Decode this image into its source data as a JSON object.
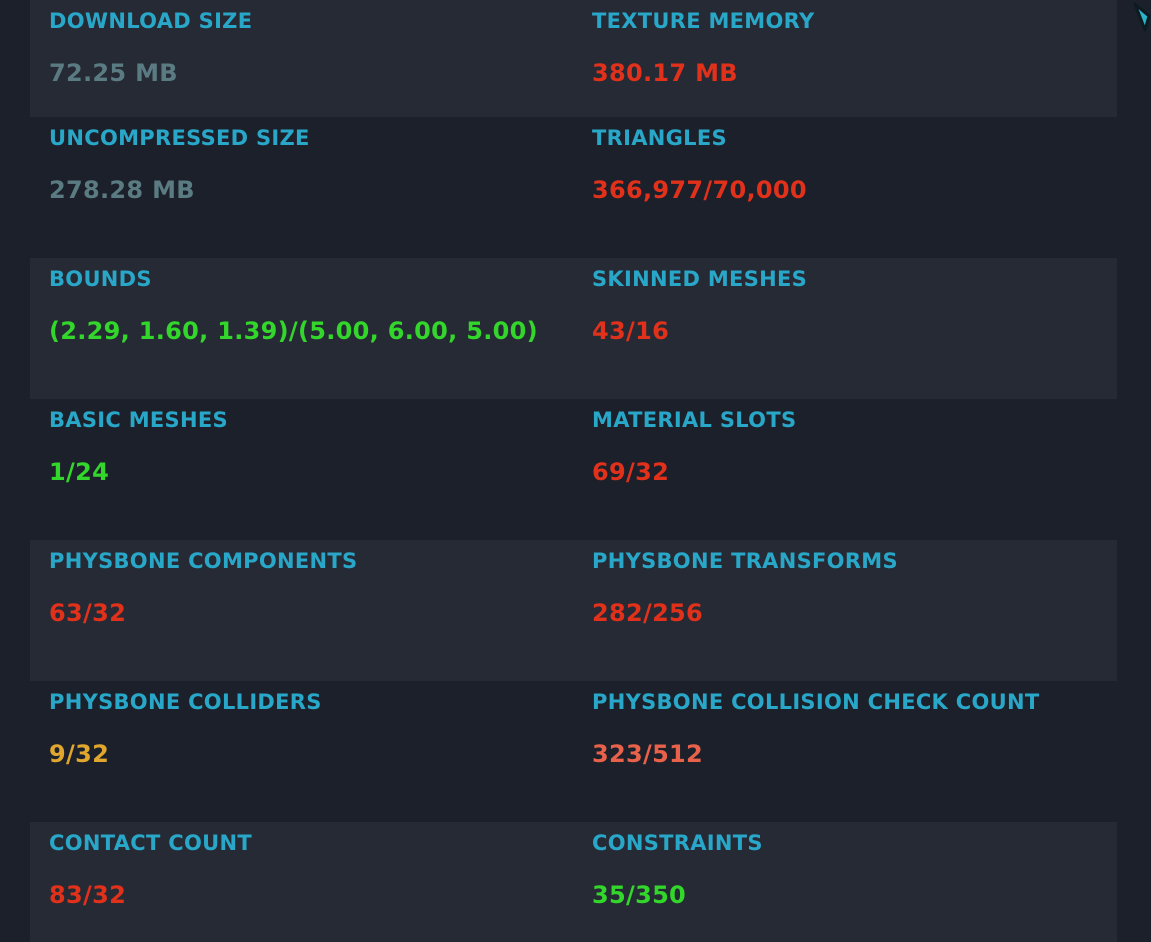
{
  "colors": {
    "label": "#29a7c8",
    "neutral": "#5b7b83",
    "bad": "#e2311b",
    "good": "#33d62a",
    "warn": "#e0a62e",
    "medium": "#e8614b"
  },
  "stats": [
    {
      "label": "DOWNLOAD SIZE",
      "value": "72.25 MB",
      "status": "neutral"
    },
    {
      "label": "TEXTURE MEMORY",
      "value": "380.17 MB",
      "status": "bad"
    },
    {
      "label": "UNCOMPRESSED SIZE",
      "value": "278.28 MB",
      "status": "neutral"
    },
    {
      "label": "TRIANGLES",
      "value": "366,977/70,000",
      "status": "bad"
    },
    {
      "label": "BOUNDS",
      "value": "(2.29, 1.60, 1.39)/(5.00, 6.00, 5.00)",
      "status": "good"
    },
    {
      "label": "SKINNED MESHES",
      "value": "43/16",
      "status": "bad"
    },
    {
      "label": "BASIC MESHES",
      "value": "1/24",
      "status": "good"
    },
    {
      "label": "MATERIAL SLOTS",
      "value": "69/32",
      "status": "bad"
    },
    {
      "label": "PHYSBONE COMPONENTS",
      "value": "63/32",
      "status": "bad"
    },
    {
      "label": "PHYSBONE TRANSFORMS",
      "value": "282/256",
      "status": "bad"
    },
    {
      "label": "PHYSBONE COLLIDERS",
      "value": "9/32",
      "status": "warn"
    },
    {
      "label": "PHYSBONE COLLISION CHECK COUNT",
      "value": "323/512",
      "status": "medium"
    },
    {
      "label": "CONTACT COUNT",
      "value": "83/32",
      "status": "bad"
    },
    {
      "label": "CONSTRAINTS",
      "value": "35/350",
      "status": "good"
    }
  ],
  "corner_icon": "cursor-arrow-icon"
}
